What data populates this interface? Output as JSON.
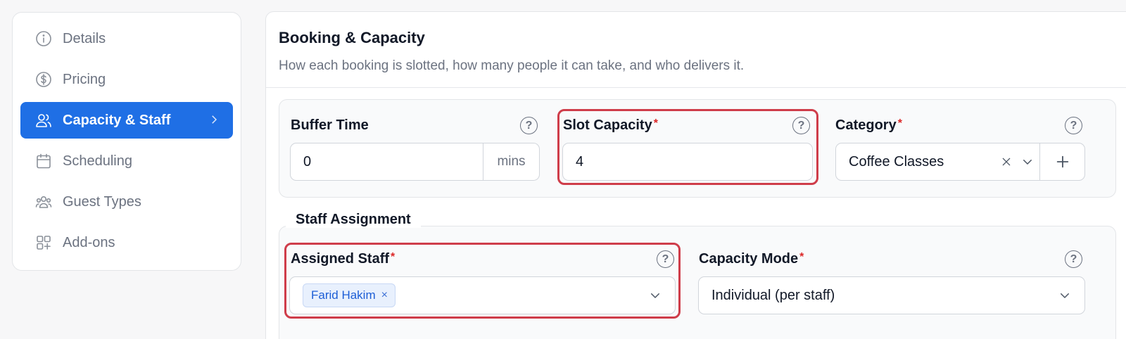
{
  "sidebar": {
    "items": [
      {
        "label": "Details",
        "icon": "info-icon",
        "active": false
      },
      {
        "label": "Pricing",
        "icon": "dollar-icon",
        "active": false
      },
      {
        "label": "Capacity & Staff",
        "icon": "users-icon",
        "active": true
      },
      {
        "label": "Scheduling",
        "icon": "calendar-icon",
        "active": false
      },
      {
        "label": "Guest Types",
        "icon": "group-icon",
        "active": false
      },
      {
        "label": "Add-ons",
        "icon": "grid-plus-icon",
        "active": false
      }
    ]
  },
  "main": {
    "title": "Booking & Capacity",
    "subtitle": "How each booking is slotted, how many people it can take, and who delivers it."
  },
  "fields": {
    "buffer_time": {
      "label": "Buffer Time",
      "value": "0",
      "unit": "mins"
    },
    "slot_capacity": {
      "label": "Slot Capacity",
      "required": "*",
      "value": "4"
    },
    "category": {
      "label": "Category",
      "required": "*",
      "value": "Coffee Classes"
    },
    "staff_section": "Staff Assignment",
    "assigned_staff": {
      "label": "Assigned Staff",
      "required": "*",
      "chip": "Farid Hakim",
      "chip_remove": "×"
    },
    "capacity_mode": {
      "label": "Capacity Mode",
      "required": "*",
      "value": "Individual (per staff)"
    }
  },
  "help_glyph": "?",
  "colors": {
    "accent": "#1f6fe5",
    "highlight": "#cf3d4a",
    "required": "#dc2626"
  }
}
